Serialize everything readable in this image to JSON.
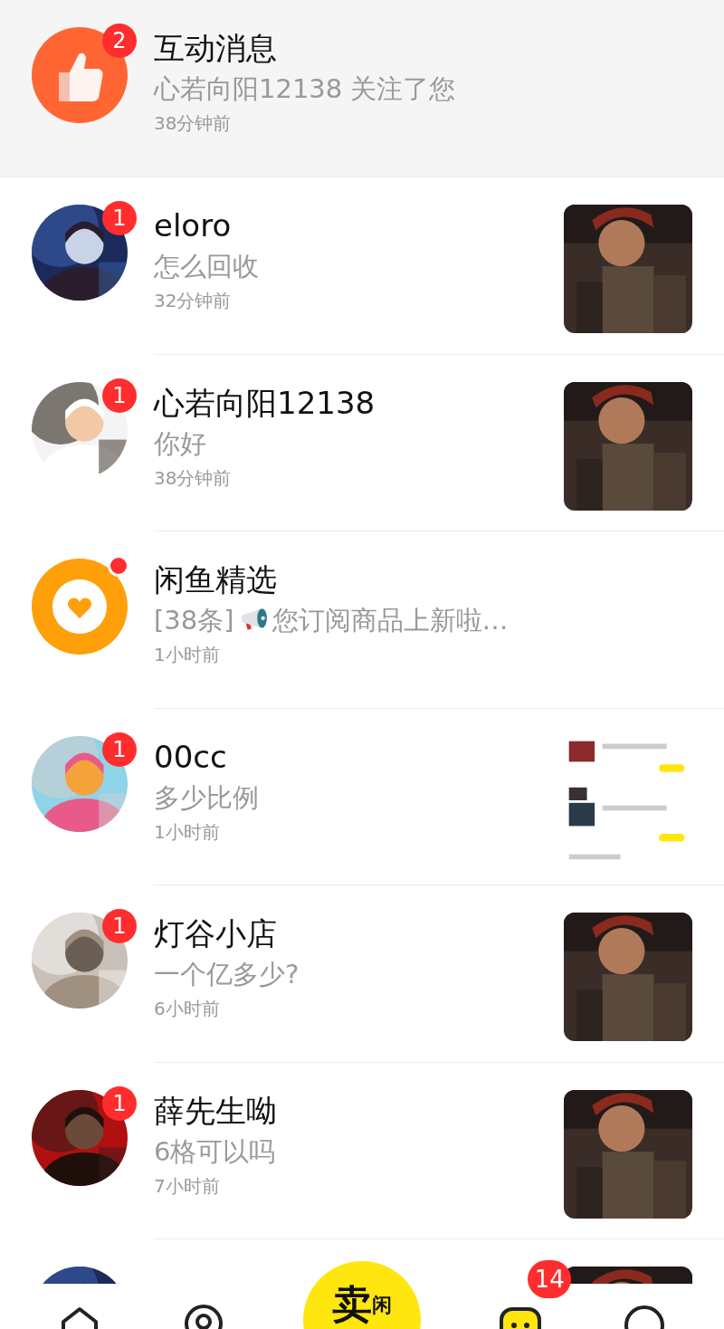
{
  "interactive": {
    "avatar": {
      "kind": "thumbs-up"
    },
    "badge": {
      "kind": "count",
      "count": "2"
    },
    "name": "互动消息",
    "preview": "心若向阳12138 关注了您",
    "time": "38分钟前"
  },
  "conversations": [
    {
      "kind": "chat",
      "badge": {
        "kind": "count",
        "count": "1"
      },
      "name": "eloro",
      "preview": "怎么回收",
      "time": "32分钟前"
    },
    {
      "kind": "chat",
      "badge": {
        "kind": "count",
        "count": "1"
      },
      "name": "心若向阳12138",
      "preview": "你好",
      "time": "38分钟前"
    },
    {
      "kind": "broadcast",
      "avatar": {
        "kind": "heart"
      },
      "badge": {
        "kind": "dot"
      },
      "name": "闲鱼精选",
      "preview_prefix": "[38条]",
      "preview": "您订阅商品上新啦…",
      "time": "1小时前"
    },
    {
      "kind": "chat",
      "badge": {
        "kind": "count",
        "count": "1"
      },
      "name": "00cc",
      "preview": "多少比例",
      "time": "1小时前"
    },
    {
      "kind": "chat",
      "badge": {
        "kind": "count",
        "count": "1"
      },
      "name": "灯谷小店",
      "preview": "一个亿多少?",
      "time": "6小时前"
    },
    {
      "kind": "chat",
      "badge": {
        "kind": "count",
        "count": "1"
      },
      "name": "薛先生呦",
      "preview": "6格可以吗",
      "time": "7小时前"
    },
    {
      "kind": "chat"
    }
  ],
  "tab_bar": [
    {
      "kind": "home",
      "selected": false
    },
    {
      "kind": "pin",
      "selected": false
    },
    {
      "kind": "sell",
      "label": "卖",
      "tag": "闲"
    },
    {
      "kind": "messages",
      "selected": true,
      "badge": "14"
    },
    {
      "kind": "profile",
      "selected": false
    }
  ]
}
